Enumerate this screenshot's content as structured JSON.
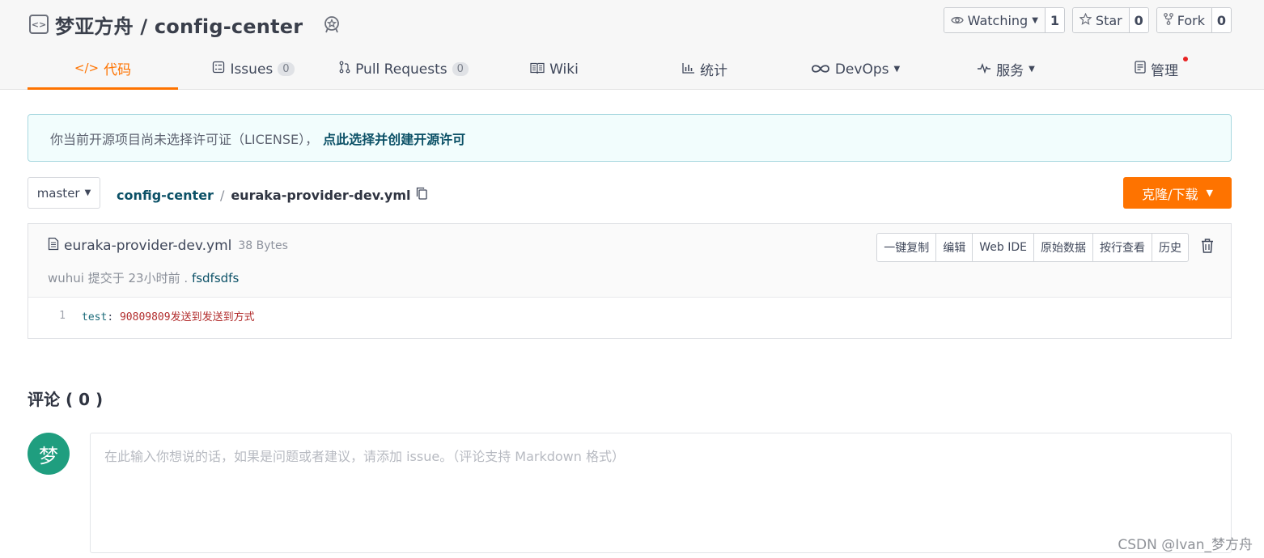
{
  "header": {
    "repo_title": "梦亚方舟 / config-center",
    "repo_icon": "repo-code-icon",
    "badge_icon": "award-badge-icon",
    "watching": {
      "label": "Watching",
      "count": "1"
    },
    "star": {
      "label": "Star",
      "count": "0"
    },
    "fork": {
      "label": "Fork",
      "count": "0"
    }
  },
  "tabs": [
    {
      "label": "代码",
      "icon": "code-icon",
      "count": ""
    },
    {
      "label": "Issues",
      "icon": "issues-icon",
      "count": "0"
    },
    {
      "label": "Pull Requests",
      "icon": "pull-request-icon",
      "count": "0"
    },
    {
      "label": "Wiki",
      "icon": "book-icon",
      "count": ""
    },
    {
      "label": "统计",
      "icon": "bar-chart-icon",
      "count": ""
    },
    {
      "label": "DevOps",
      "icon": "infinity-icon",
      "count": ""
    },
    {
      "label": "服务",
      "icon": "pulse-icon",
      "count": ""
    },
    {
      "label": "管理",
      "icon": "manage-icon",
      "count": ""
    }
  ],
  "notice": {
    "text": "你当前开源项目尚未选择许可证（LICENSE），",
    "link": "点此选择并创建开源许可"
  },
  "branch": {
    "label": "master"
  },
  "breadcrumb": {
    "root": "config-center",
    "separator": "/",
    "file": "euraka-provider-dev.yml"
  },
  "clone_button": {
    "label": "克隆/下载"
  },
  "file": {
    "name": "euraka-provider-dev.yml",
    "size": "38 Bytes",
    "commit_author": "wuhui",
    "commit_info": "提交于 23小时前 .",
    "commit_message": "fsdfsdfs",
    "tools": [
      "一键复制",
      "编辑",
      "Web IDE",
      "原始数据",
      "按行查看",
      "历史"
    ],
    "code": {
      "line_number": "1",
      "key": "test",
      "punct": ":",
      "value": "90809809发送到发送到方式"
    }
  },
  "comments": {
    "title": "评论 ( 0 )",
    "avatar_text": "梦",
    "placeholder": "在此输入你想说的话，如果是问题或者建议，请添加 issue。（评论支持 Markdown 格式）"
  },
  "watermark": "CSDN @Ivan_梦方舟",
  "colors": {
    "accent": "#fe7300",
    "link": "#0c5167",
    "avatar": "#1f9e7f",
    "notice_bg": "#f2fdfd"
  }
}
